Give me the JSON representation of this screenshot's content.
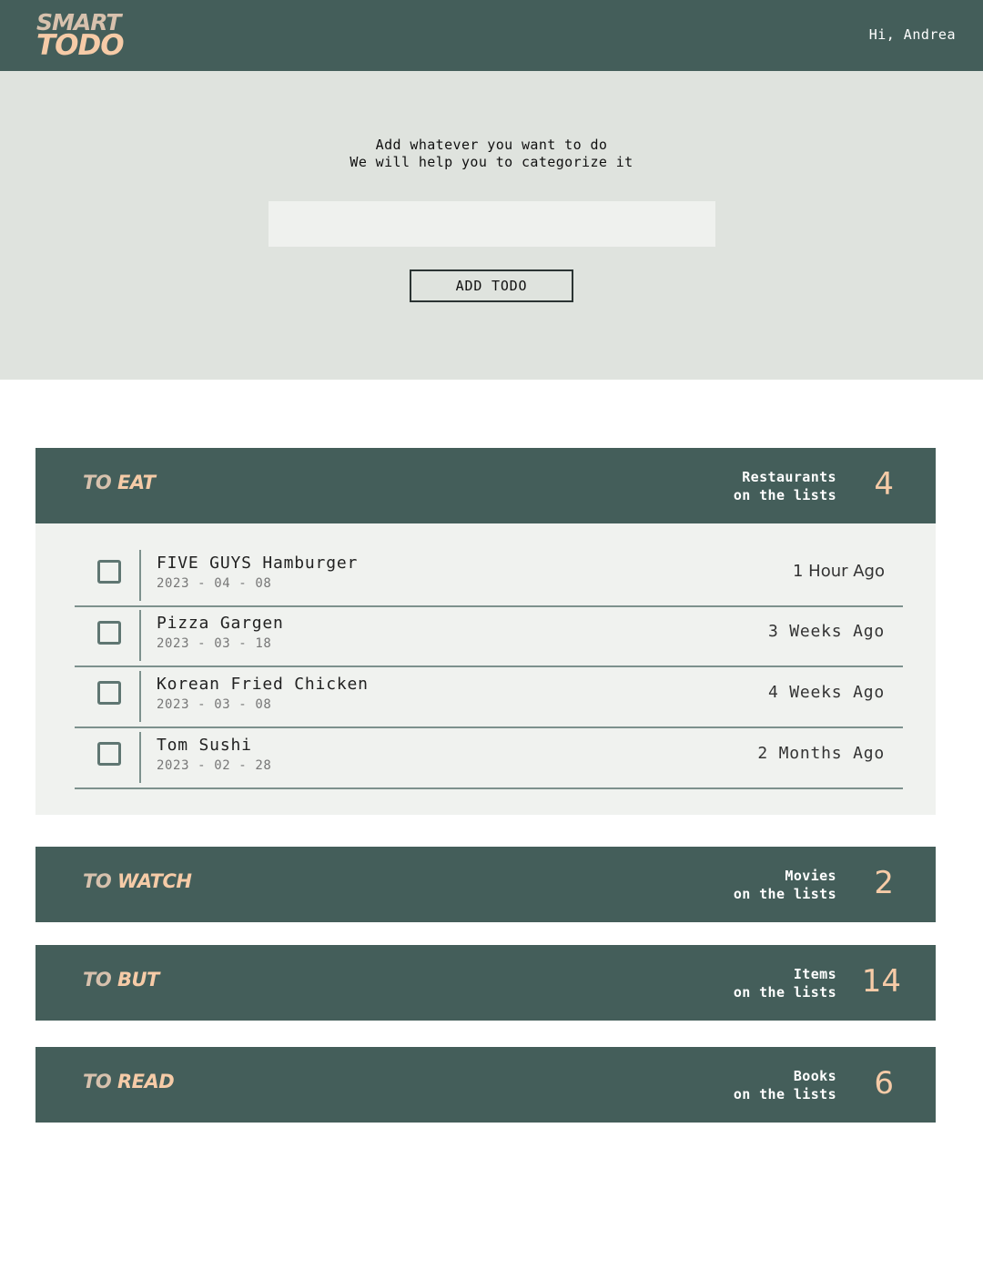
{
  "header": {
    "logo_top": "SMART",
    "logo_bottom": "TODO",
    "greeting": "Hi, Andrea"
  },
  "hero": {
    "line1": "Add whatever you want to do",
    "line2": "We will help you to categorize it",
    "input_value": "",
    "input_placeholder": "",
    "button_label": "ADD TODO"
  },
  "categories": [
    {
      "prefix": "TO",
      "title": "EAT",
      "desc_line1": "Restaurants",
      "desc_line2": "on the lists",
      "count": "4",
      "items": [
        {
          "name": "FIVE GUYS Hamburger",
          "date": "2023 - 04 - 08",
          "ago": "1 Hour Ago"
        },
        {
          "name": "Pizza Gargen",
          "date": "2023 - 03 - 18",
          "ago": "3 Weeks Ago"
        },
        {
          "name": "Korean Fried Chicken",
          "date": "2023 - 03 - 08",
          "ago": "4 Weeks Ago"
        },
        {
          "name": "Tom Sushi",
          "date": "2023 - 02 - 28",
          "ago": "2 Months Ago"
        }
      ]
    },
    {
      "prefix": "TO",
      "title": "WATCH",
      "desc_line1": "Movies",
      "desc_line2": "on the lists",
      "count": "2"
    },
    {
      "prefix": "TO",
      "title": "BUT",
      "desc_line1": "Items",
      "desc_line2": "on the lists",
      "count": "14"
    },
    {
      "prefix": "TO",
      "title": "READ",
      "desc_line1": "Books",
      "desc_line2": "on the lists",
      "count": "6"
    }
  ],
  "colors": {
    "header_bg": "#445e5a",
    "accent": "#f6cba7",
    "hero_bg": "#dfe3de",
    "list_bg": "#f0f2ef"
  }
}
